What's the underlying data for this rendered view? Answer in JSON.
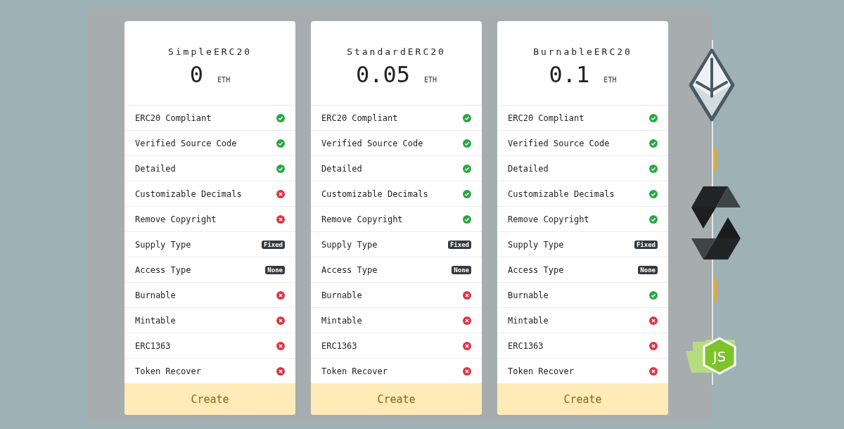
{
  "plans": [
    {
      "name": "SimpleERC20",
      "price": "0",
      "currency": "ETH",
      "features": [
        {
          "label": "ERC20 Compliant",
          "kind": "check",
          "enabled": true
        },
        {
          "label": "Verified Source Code",
          "kind": "check",
          "enabled": true
        },
        {
          "label": "Detailed",
          "kind": "check",
          "enabled": true
        },
        {
          "label": "Customizable Decimals",
          "kind": "check",
          "enabled": false
        },
        {
          "label": "Remove Copyright",
          "kind": "check",
          "enabled": false
        },
        {
          "label": "Supply Type",
          "kind": "badge",
          "badge": "Fixed"
        },
        {
          "label": "Access Type",
          "kind": "badge",
          "badge": "None"
        },
        {
          "label": "Burnable",
          "kind": "check",
          "enabled": false
        },
        {
          "label": "Mintable",
          "kind": "check",
          "enabled": false
        },
        {
          "label": "ERC1363",
          "kind": "check",
          "enabled": false
        },
        {
          "label": "Token Recover",
          "kind": "check",
          "enabled": false
        }
      ],
      "button": "Create"
    },
    {
      "name": "StandardERC20",
      "price": "0.05",
      "currency": "ETH",
      "features": [
        {
          "label": "ERC20 Compliant",
          "kind": "check",
          "enabled": true
        },
        {
          "label": "Verified Source Code",
          "kind": "check",
          "enabled": true
        },
        {
          "label": "Detailed",
          "kind": "check",
          "enabled": true
        },
        {
          "label": "Customizable Decimals",
          "kind": "check",
          "enabled": true
        },
        {
          "label": "Remove Copyright",
          "kind": "check",
          "enabled": true
        },
        {
          "label": "Supply Type",
          "kind": "badge",
          "badge": "Fixed"
        },
        {
          "label": "Access Type",
          "kind": "badge",
          "badge": "None"
        },
        {
          "label": "Burnable",
          "kind": "check",
          "enabled": false
        },
        {
          "label": "Mintable",
          "kind": "check",
          "enabled": false
        },
        {
          "label": "ERC1363",
          "kind": "check",
          "enabled": false
        },
        {
          "label": "Token Recover",
          "kind": "check",
          "enabled": false
        }
      ],
      "button": "Create"
    },
    {
      "name": "BurnableERC20",
      "price": "0.1",
      "currency": "ETH",
      "features": [
        {
          "label": "ERC20 Compliant",
          "kind": "check",
          "enabled": true
        },
        {
          "label": "Verified Source Code",
          "kind": "check",
          "enabled": true
        },
        {
          "label": "Detailed",
          "kind": "check",
          "enabled": true
        },
        {
          "label": "Customizable Decimals",
          "kind": "check",
          "enabled": true
        },
        {
          "label": "Remove Copyright",
          "kind": "check",
          "enabled": true
        },
        {
          "label": "Supply Type",
          "kind": "badge",
          "badge": "Fixed"
        },
        {
          "label": "Access Type",
          "kind": "badge",
          "badge": "None"
        },
        {
          "label": "Burnable",
          "kind": "check",
          "enabled": true
        },
        {
          "label": "Mintable",
          "kind": "check",
          "enabled": false
        },
        {
          "label": "ERC1363",
          "kind": "check",
          "enabled": false
        },
        {
          "label": "Token Recover",
          "kind": "check",
          "enabled": false
        }
      ],
      "button": "Create"
    }
  ],
  "side_logo": {
    "text": "JS"
  }
}
